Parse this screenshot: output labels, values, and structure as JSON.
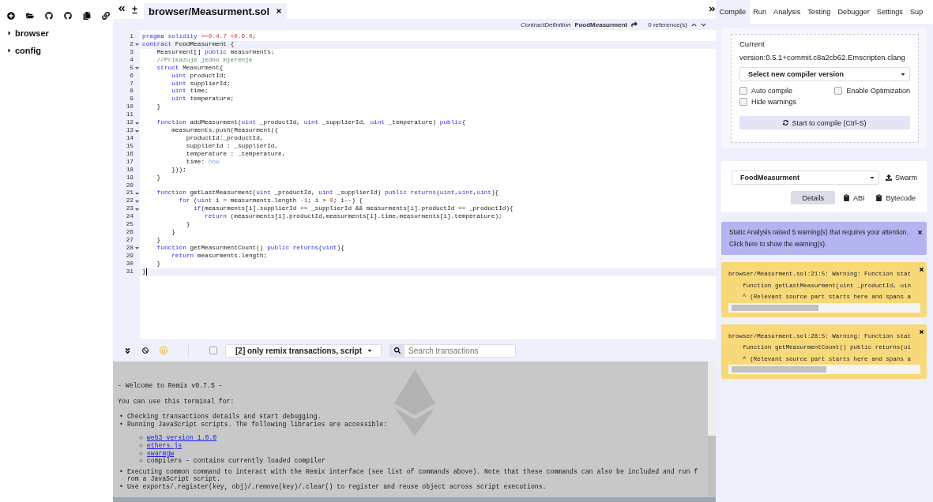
{
  "file_panel": {
    "tree": [
      {
        "label": "browser",
        "expanded": false
      },
      {
        "label": "config",
        "expanded": false
      }
    ]
  },
  "editor": {
    "tabs": [
      {
        "label": "browser/Measurment.sol",
        "selected": true
      }
    ],
    "context": {
      "kind_label": "ContractDefinition",
      "name": "FoodMeasurment",
      "references": "0 reference(s)"
    },
    "lines": [
      {
        "number": "1",
        "segments": [
          {
            "kind": "kw",
            "text": "pragma solidity "
          },
          {
            "kind": "num",
            "text": ">=0.4.7 <0.6.0"
          },
          {
            "kind": "pl",
            "text": ";"
          }
        ]
      },
      {
        "number": "2",
        "fold": true,
        "highlighted": true,
        "segments": [
          {
            "kind": "kw",
            "text": "contract"
          },
          {
            "kind": "pl",
            "text": " FoodMeasurment {"
          }
        ]
      },
      {
        "number": "3",
        "segments": [
          {
            "kind": "pl",
            "text": "    Measurment[] "
          },
          {
            "kind": "kw",
            "text": "public"
          },
          {
            "kind": "pl",
            "text": " measurments;"
          }
        ]
      },
      {
        "number": "4",
        "segments": [
          {
            "kind": "cm",
            "text": "    //Prikazuje jedno mjerenje"
          }
        ]
      },
      {
        "number": "5",
        "fold": true,
        "segments": [
          {
            "kind": "kw",
            "text": "    struct"
          },
          {
            "kind": "pl",
            "text": " Measurment{"
          }
        ]
      },
      {
        "number": "6",
        "segments": [
          {
            "kind": "kw",
            "text": "        uint"
          },
          {
            "kind": "pl",
            "text": " productId;"
          }
        ]
      },
      {
        "number": "7",
        "segments": [
          {
            "kind": "kw",
            "text": "        uint"
          },
          {
            "kind": "pl",
            "text": " supplierId;"
          }
        ]
      },
      {
        "number": "8",
        "segments": [
          {
            "kind": "kw",
            "text": "        uint"
          },
          {
            "kind": "pl",
            "text": " time;"
          }
        ]
      },
      {
        "number": "9",
        "segments": [
          {
            "kind": "kw",
            "text": "        uint"
          },
          {
            "kind": "pl",
            "text": " temperature;"
          }
        ]
      },
      {
        "number": "10",
        "segments": [
          {
            "kind": "pl",
            "text": "    }"
          }
        ]
      },
      {
        "number": "11"
      },
      {
        "number": "12",
        "fold": true,
        "segments": [
          {
            "kind": "kw",
            "text": "    function"
          },
          {
            "kind": "pl",
            "text": " addMeasurment("
          },
          {
            "kind": "kw",
            "text": "uint"
          },
          {
            "kind": "pl",
            "text": " _productId, "
          },
          {
            "kind": "kw",
            "text": "uint"
          },
          {
            "kind": "pl",
            "text": " _supplierId, "
          },
          {
            "kind": "kw",
            "text": "uint"
          },
          {
            "kind": "pl",
            "text": " _temperature) "
          },
          {
            "kind": "kw",
            "text": "public"
          },
          {
            "kind": "pl",
            "text": "{"
          }
        ]
      },
      {
        "number": "13",
        "fold": true,
        "segments": [
          {
            "kind": "pl",
            "text": "        measurments.push(Measurment({"
          }
        ]
      },
      {
        "number": "14",
        "segments": [
          {
            "kind": "pl",
            "text": "            productId:_productId,"
          }
        ]
      },
      {
        "number": "15",
        "segments": [
          {
            "kind": "pl",
            "text": "            supplierId : _supplierId,"
          }
        ]
      },
      {
        "number": "16",
        "segments": [
          {
            "kind": "pl",
            "text": "            temperature : _temperature,"
          }
        ]
      },
      {
        "number": "17",
        "segments": [
          {
            "kind": "pl",
            "text": "            time: "
          },
          {
            "kind": "lit",
            "text": "now"
          }
        ]
      },
      {
        "number": "18",
        "segments": [
          {
            "kind": "pl",
            "text": "        }));"
          }
        ]
      },
      {
        "number": "19",
        "segments": [
          {
            "kind": "pl",
            "text": "    }"
          }
        ]
      },
      {
        "number": "20"
      },
      {
        "number": "21",
        "fold": true,
        "segments": [
          {
            "kind": "kw",
            "text": "    function"
          },
          {
            "kind": "pl",
            "text": " getLastMeasurment("
          },
          {
            "kind": "kw",
            "text": "uint"
          },
          {
            "kind": "pl",
            "text": " _productId, "
          },
          {
            "kind": "kw",
            "text": "uint"
          },
          {
            "kind": "pl",
            "text": " _supplierId) "
          },
          {
            "kind": "kw",
            "text": "public returns"
          },
          {
            "kind": "pl",
            "text": "("
          },
          {
            "kind": "kw",
            "text": "uint"
          },
          {
            "kind": "pl",
            "text": ","
          },
          {
            "kind": "kw",
            "text": "uint"
          },
          {
            "kind": "pl",
            "text": ","
          },
          {
            "kind": "kw",
            "text": "uint"
          },
          {
            "kind": "pl",
            "text": "){"
          }
        ]
      },
      {
        "number": "22",
        "fold": true,
        "segments": [
          {
            "kind": "kw",
            "text": "          for"
          },
          {
            "kind": "pl",
            "text": " ("
          },
          {
            "kind": "kw",
            "text": "uint"
          },
          {
            "kind": "pl",
            "text": " i = measurments.length "
          },
          {
            "kind": "num",
            "text": "-1"
          },
          {
            "kind": "pl",
            "text": "; i > "
          },
          {
            "kind": "num",
            "text": "0"
          },
          {
            "kind": "pl",
            "text": "; i--) {"
          }
        ]
      },
      {
        "number": "23",
        "fold": true,
        "segments": [
          {
            "kind": "kw",
            "text": "              if"
          },
          {
            "kind": "pl",
            "text": "(measurments[i].supplierId == _supplierId && measurments[i].productId == _productId){"
          }
        ]
      },
      {
        "number": "24",
        "segments": [
          {
            "kind": "kw",
            "text": "                 return"
          },
          {
            "kind": "pl",
            "text": " (measurments[i].productId,measurments[i].time,measurments[i].temperature);"
          }
        ]
      },
      {
        "number": "25",
        "segments": [
          {
            "kind": "pl",
            "text": "            }"
          }
        ]
      },
      {
        "number": "26",
        "segments": [
          {
            "kind": "pl",
            "text": "        }"
          }
        ]
      },
      {
        "number": "27",
        "segments": [
          {
            "kind": "pl",
            "text": "    }"
          }
        ]
      },
      {
        "number": "28",
        "fold": true,
        "segments": [
          {
            "kind": "kw",
            "text": "    function"
          },
          {
            "kind": "pl",
            "text": " getMeasurmentCount() "
          },
          {
            "kind": "kw",
            "text": "public returns"
          },
          {
            "kind": "pl",
            "text": "("
          },
          {
            "kind": "kw",
            "text": "uint"
          },
          {
            "kind": "pl",
            "text": "){"
          }
        ]
      },
      {
        "number": "29",
        "segments": [
          {
            "kind": "kw",
            "text": "        return"
          },
          {
            "kind": "pl",
            "text": " measurments.length;"
          }
        ]
      },
      {
        "number": "30",
        "segments": [
          {
            "kind": "pl",
            "text": "    }"
          }
        ]
      },
      {
        "number": "31",
        "highlighted": true,
        "cursor": true,
        "segments": [
          {
            "kind": "pl",
            "text": "}"
          }
        ]
      }
    ]
  },
  "terminal": {
    "pending_count": "0",
    "filter_checked": false,
    "filter": "[2] only remix transactions, script",
    "search": {
      "placeholder": "Search transactions"
    },
    "welcome": "- Welcome to Remix v0.7.5 -",
    "intro": "You can use this terminal for:",
    "bullets": [
      {
        "marker": "•",
        "text": "Checking transactions details and start debugging."
      },
      {
        "marker": "•",
        "text": "Running JavaScript scripts. The following libraries are accessible:",
        "children": [
          {
            "marker": "○",
            "text": "web3 version 1.0.0",
            "link": true
          },
          {
            "marker": "○",
            "text": "ethers.js",
            "link": true
          },
          {
            "marker": "○",
            "text": "swarmgw",
            "link": true
          },
          {
            "marker": "○",
            "text": "compilers - contains currently loaded compiler",
            "link": false
          }
        ]
      },
      {
        "marker": "•",
        "text": "Executing common command to interact with the Remix interface (see list of commands above). Note that these commands can also be included and run from a JavaScript script."
      },
      {
        "marker": "•",
        "text": "Use exports/.register(key, obj)/.remove(key)/.clear() to register and reuse object across script executions."
      }
    ]
  },
  "right_panel": {
    "tabs": [
      {
        "label": "Compile",
        "selected": true
      },
      {
        "label": "Run",
        "selected": false
      },
      {
        "label": "Analysis",
        "selected": false
      },
      {
        "label": "Testing",
        "selected": false
      },
      {
        "label": "Debugger",
        "selected": false
      },
      {
        "label": "Settings",
        "selected": false
      },
      {
        "label": "Sup",
        "selected": false
      }
    ],
    "compiler": {
      "current_label": "Current",
      "version": "version:0.5.1+commit.c8a2cb62.Emscripten.clang",
      "select": "Select new compiler version",
      "options": [
        {
          "label": "Auto compile",
          "checked": false
        },
        {
          "label": "Enable Optimization",
          "checked": false
        },
        {
          "label": "Hide warnings",
          "checked": false
        }
      ],
      "compile_button": "Start to compile (Ctrl-S)"
    },
    "contract": {
      "select": "FoodMeasurment",
      "swarm": "Swarm",
      "buttons": [
        {
          "label": "Details",
          "kind": "plain"
        },
        {
          "label": "ABI",
          "kind": "copy"
        },
        {
          "label": "Bytecode",
          "kind": "copy"
        }
      ]
    },
    "analysis_alert": {
      "lines": [
        "Static Analysis raised 5 warning(s) that requires your attention.",
        "Click here to show the warning(s)."
      ]
    },
    "warnings": [
      {
        "lines": [
          "browser/Measurment.sol:21:5: Warning: Function stat",
          "    function getLastMeasurment(uint _productId, uin",
          "    ^ (Relevant source part starts here and spans a"
        ]
      },
      {
        "lines": [
          "browser/Measurment.sol:28:5: Warning: Function stat",
          "    function getMeasurmentCount() public returns(ui",
          "    ^ (Relevant source part starts here and spans a"
        ]
      }
    ]
  }
}
